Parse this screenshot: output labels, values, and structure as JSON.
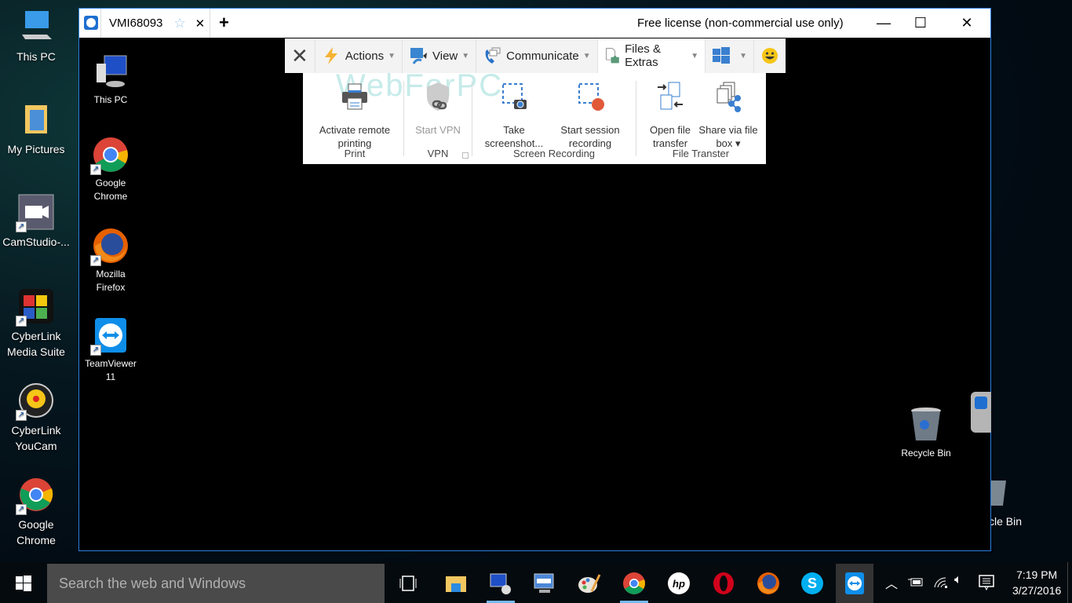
{
  "desktop_left": [
    {
      "label": "This PC",
      "icon": "this-pc-icon"
    },
    {
      "label": "My Pictures",
      "icon": "folder-pictures-icon"
    },
    {
      "label": "CamStudio-...",
      "icon": "camstudio-icon"
    },
    {
      "label": "CyberLink Media Suite",
      "icon": "cyberlink-media-suite-icon"
    },
    {
      "label": "CyberLink YouCam",
      "icon": "cyberlink-youcam-icon"
    },
    {
      "label": "Google Chrome",
      "icon": "chrome-icon"
    }
  ],
  "desktop_right_partial": {
    "label": "cle Bin",
    "icon": "recycle-bin-icon"
  },
  "remote_desktop": [
    {
      "label": "This PC",
      "icon": "this-pc-icon"
    },
    {
      "label": "Google Chrome",
      "icon": "chrome-icon"
    },
    {
      "label": "Mozilla Firefox",
      "icon": "firefox-icon"
    },
    {
      "label": "TeamViewer 11",
      "icon": "teamviewer-icon"
    },
    {
      "label": "Recycle Bin",
      "icon": "recycle-bin-icon"
    }
  ],
  "window": {
    "tab_title": "VMI68093",
    "new_tab": "+",
    "license": "Free license (non-commercial use only)",
    "minimize": "—",
    "maximize": "☐",
    "close": "✕"
  },
  "toolbar": {
    "close": "✕",
    "items": [
      {
        "label": "Actions"
      },
      {
        "label": "View"
      },
      {
        "label": "Communicate"
      },
      {
        "label": "Files & Extras"
      }
    ]
  },
  "ribbon": {
    "watermark": "WebForPC",
    "buttons": {
      "print": "Activate remote printing",
      "vpn": "Start VPN",
      "screenshot": "Take screenshot...",
      "recording": "Start session recording",
      "file_transfer": "Open file transfer",
      "file_box": "Share via file box ▾"
    },
    "groups": {
      "print": "Print",
      "vpn": "VPN",
      "screen_recording": "Screen Recording",
      "file_transfer": "File Transter"
    }
  },
  "taskbar": {
    "search_placeholder": "Search the web and Windows",
    "time": "7:19 PM",
    "date": "3/27/2016"
  }
}
